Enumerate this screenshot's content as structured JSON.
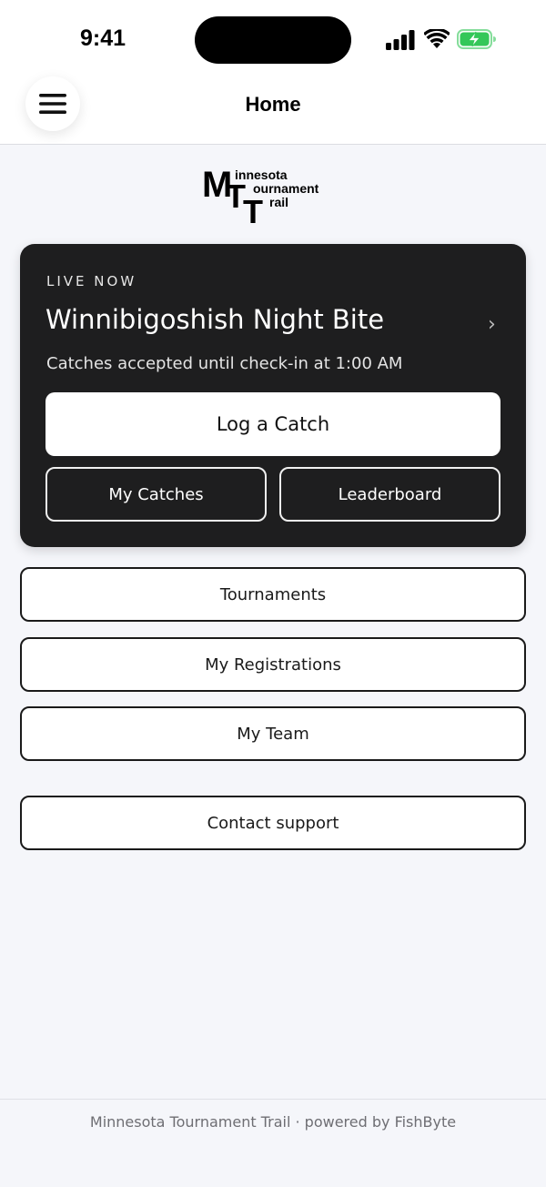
{
  "status_bar": {
    "time": "9:41",
    "icons": [
      "signal-icon",
      "wifi-icon",
      "battery-charging-icon"
    ],
    "battery_color": "#34c759"
  },
  "header": {
    "title": "Home",
    "menu_icon": "hamburger-menu-icon"
  },
  "logo": {
    "line1": "innesota",
    "line2": "ournament",
    "line3": "rail",
    "initials": [
      "M",
      "T",
      "T"
    ]
  },
  "live_event": {
    "label": "LIVE NOW",
    "name": "Winnibigoshish Night Bite",
    "subtitle": "Catches accepted until check-in at 1:00 AM",
    "chevron": "›",
    "primary_action": "Log a Catch",
    "secondary_actions": [
      "My Catches",
      "Leaderboard"
    ],
    "card_color": "#1e1e1f"
  },
  "menu": {
    "items": [
      "Tournaments",
      "My Registrations",
      "My Team"
    ],
    "support": "Contact support"
  },
  "footer": {
    "text": "Minnesota Tournament Trail · powered by FishByte"
  }
}
